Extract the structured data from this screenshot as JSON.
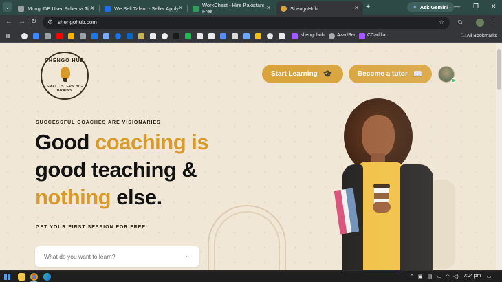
{
  "browser": {
    "tabs": [
      {
        "title": "MongoDB User Schema Tips",
        "favicon_color": "#9aa0a6"
      },
      {
        "title": "We Sell Talent - Seller Apply",
        "favicon_color": "#1f6feb"
      },
      {
        "title": "WorkChest - Hire Pakistani Free",
        "favicon_color": "#2e9e5b"
      },
      {
        "title": "ShengoHub",
        "favicon_color": "#d9a43c",
        "active": true
      }
    ],
    "new_tab_symbol": "+",
    "gemini_label": "Ask Gemini",
    "url": "shengohub.com",
    "bookmarks": [
      {
        "label": "shengohub",
        "icon_color": "#a259ff"
      },
      {
        "label": "AzadSeo",
        "icon_color": "#aaaaaa"
      },
      {
        "label": "CCadillac",
        "icon_color": "#a259ff"
      }
    ],
    "all_bookmarks_label": "All Bookmarks"
  },
  "header": {
    "logo_top_text": "SHENGO HUB",
    "logo_bottom_text": "SMALL STEPS BIG BRAINS",
    "start_learning_label": "Start Learning",
    "become_tutor_label": "Become a tutor"
  },
  "hero": {
    "eyebrow": "SUCCESSFUL COACHES ARE VISIONARIES",
    "headline_parts": {
      "p1": "Good ",
      "p2": "coaching is",
      "p3": "good teaching &",
      "p4": "nothing",
      "p5": " else."
    },
    "session_label": "GET YOUR FIRST SESSION FOR FREE",
    "search_placeholder": "What do you want to learn?"
  },
  "taskbar": {
    "time": "7:04 pm"
  },
  "colors": {
    "accent": "#d9a43c",
    "page_bg": "#f1e7d6",
    "headline_accent": "#d89a2a"
  }
}
